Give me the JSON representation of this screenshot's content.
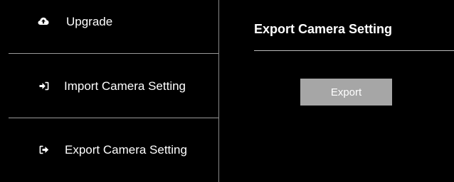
{
  "sidebar": {
    "items": [
      {
        "label": "Upgrade",
        "icon": "cloud-upload-icon"
      },
      {
        "label": "Import Camera Setting",
        "icon": "sign-in-icon"
      },
      {
        "label": "Export Camera Setting",
        "icon": "sign-out-icon"
      }
    ]
  },
  "main": {
    "title": "Export Camera Setting",
    "export_button_label": "Export"
  },
  "colors": {
    "background": "#000000",
    "text": "#ffffff",
    "divider": "#9a9a9a",
    "button": "#a6a6a6"
  }
}
